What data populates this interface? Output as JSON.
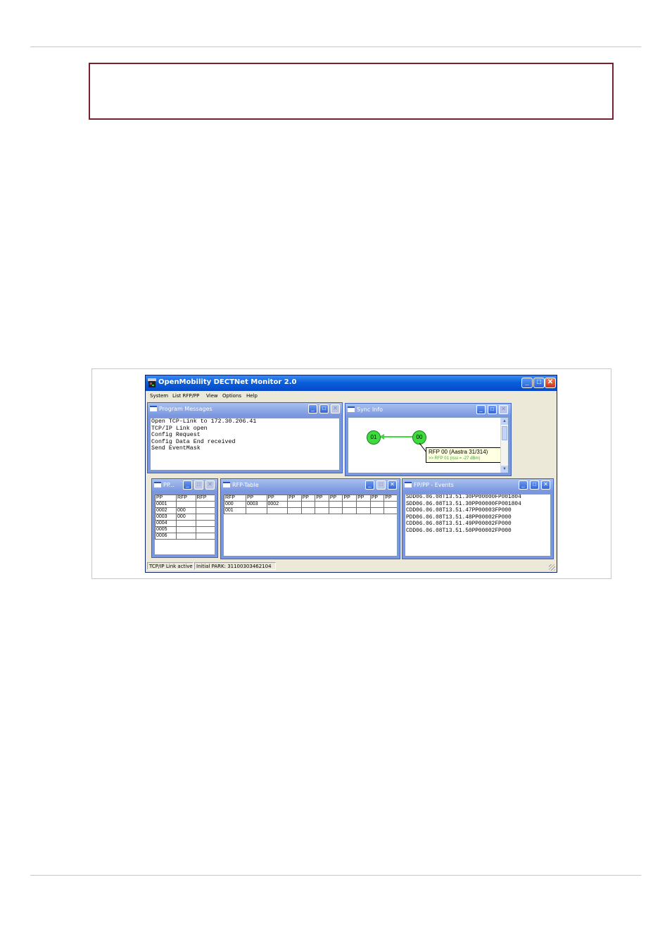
{
  "window": {
    "title": "OpenMobility DECTNet Monitor 2.0",
    "min_glyph": "_",
    "max_glyph": "□",
    "close_glyph": "✕"
  },
  "menu": {
    "items": [
      "System",
      "List RFP/PP",
      "View",
      "Options",
      "Help"
    ]
  },
  "program_messages": {
    "title": "Program Messages",
    "lines": [
      "Open TCP-Link to 172.30.206.41",
      "TCP/IP Link open",
      "Config Request",
      "Config Data End received",
      "Send EventMask"
    ]
  },
  "sync_info": {
    "title": "Sync Info",
    "node_a": "01",
    "node_b": "00",
    "tooltip_line1": "RFP 00 (Aastra 31/314)",
    "tooltip_line2": ">> RFP 01 (rssi = -27 dBm)",
    "scroll_up": "▲",
    "scroll_down": "▼"
  },
  "pp_window": {
    "title": "PP...",
    "headers": [
      "PP",
      "RFP",
      "RFP"
    ],
    "rows": [
      [
        "0001",
        "",
        ""
      ],
      [
        "0002",
        "000",
        ""
      ],
      [
        "0003",
        "000",
        ""
      ],
      [
        "0004",
        "",
        ""
      ],
      [
        "0005",
        "",
        ""
      ],
      [
        "0006",
        "",
        ""
      ]
    ]
  },
  "rfp_table": {
    "title": "RFP-Table",
    "headers": [
      "RFP",
      "PP",
      "PP",
      "PP",
      "PP",
      "PP",
      "PP",
      "PP",
      "PP",
      "PP",
      "PP"
    ],
    "rows": [
      [
        "000",
        "0003",
        "0002",
        "",
        "",
        "",
        "",
        "",
        "",
        "",
        ""
      ],
      [
        "001",
        "",
        "",
        "",
        "",
        "",
        "",
        "",
        "",
        "",
        ""
      ]
    ]
  },
  "events": {
    "title": "FP/PP - Events",
    "lines": [
      "SDD06.06.08T13.51.30PP00000FP001804",
      "SDD06.06.08T13.51.30PP00000FP001804",
      "CDD06.06.08T13.51.47PP00003FP000",
      "PDD06.06.08T13.51.48PP00002FP000",
      "CDD06.06.08T13.51.49PP00002FP000",
      "CDD06.06.08T13.51.50PP00002FP000"
    ]
  },
  "status": {
    "link": "TCP/IP Link active",
    "park": "Initial PARK: 31100303462104"
  },
  "colors": {
    "notice_border": "#7a1f2b",
    "title_blue": "#0a5fdc",
    "node_green": "#3cdc3c",
    "link_green": "#3cdc3c"
  }
}
